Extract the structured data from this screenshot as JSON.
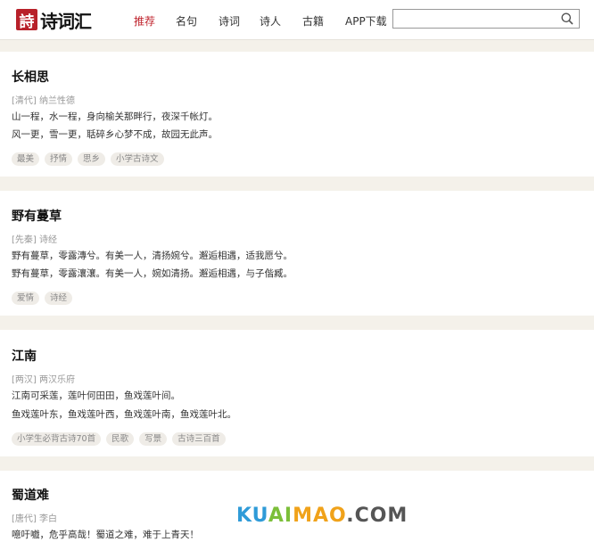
{
  "header": {
    "logo_seal": "詩",
    "logo_text": "诗词汇",
    "nav": [
      "推荐",
      "名句",
      "诗词",
      "诗人",
      "古籍",
      "APP下载"
    ],
    "search_placeholder": ""
  },
  "poems": [
    {
      "title": "长相思",
      "source": "[清代] 纳兰性德",
      "lines": [
        "山一程，水一程，身向榆关那畔行，夜深千帐灯。",
        "风一更，雪一更，聒碎乡心梦不成，故园无此声。"
      ],
      "tags": [
        "最美",
        "抒情",
        "思乡",
        "小学古诗文"
      ]
    },
    {
      "title": "野有蔓草",
      "source": "[先秦] 诗经",
      "lines": [
        "野有蔓草，零露漙兮。有美一人，清扬婉兮。邂逅相遇，适我愿兮。",
        "野有蔓草，零露瀼瀼。有美一人，婉如清扬。邂逅相遇，与子偕臧。"
      ],
      "tags": [
        "爱情",
        "诗经"
      ]
    },
    {
      "title": "江南",
      "source": "[两汉] 两汉乐府",
      "lines": [
        "江南可采莲，莲叶何田田，鱼戏莲叶间。",
        "鱼戏莲叶东，鱼戏莲叶西，鱼戏莲叶南，鱼戏莲叶北。"
      ],
      "tags": [
        "小学生必背古诗70首",
        "民歌",
        "写景",
        "古诗三百首"
      ]
    },
    {
      "title": "蜀道难",
      "source": "[唐代] 李白",
      "lines": [
        "噫吁嚱，危乎高哉！蜀道之难，难于上青天！"
      ],
      "tags": []
    }
  ],
  "watermark": {
    "k": "KU",
    "u": "AI",
    "i": "MAO",
    "dot": ".COM"
  }
}
